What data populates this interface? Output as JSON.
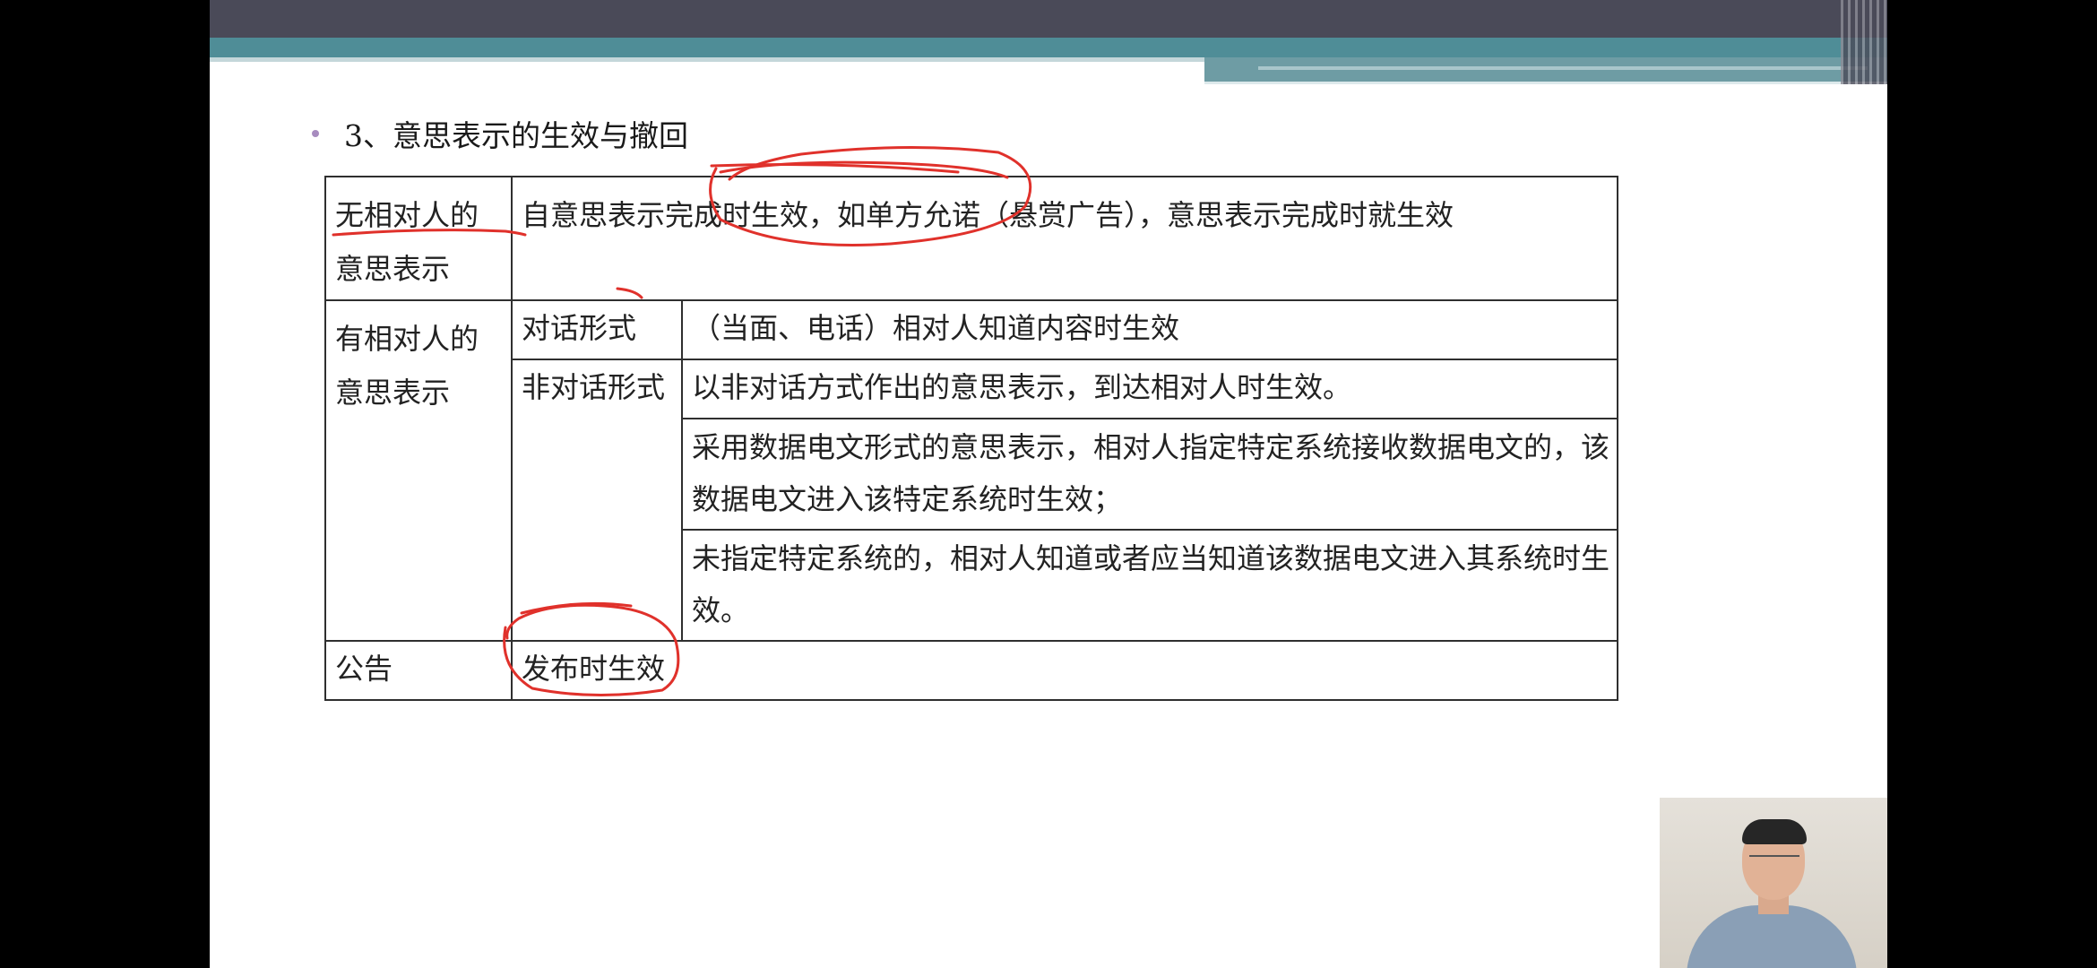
{
  "slide": {
    "heading": "3、意思表示的生效与撤回",
    "rows": {
      "no_counterparty": {
        "label": "无相对人的意思表示",
        "content": "自意思表示完成时生效，如单方允诺（悬赏广告），意思表示完成时就生效"
      },
      "with_counterparty": {
        "label": "有相对人的意思表示",
        "dialogue": {
          "form": "对话形式",
          "content": "（当面、电话）相对人知道内容时生效"
        },
        "non_dialogue": {
          "form": "非对话形式",
          "content": "以非对话方式作出的意思表示，到达相对人时生效。",
          "electronic_designated": "采用数据电文形式的意思表示，相对人指定特定系统接收数据电文的，该数据电文进入该特定系统时生效；",
          "electronic_undesignated": "未指定特定系统的，相对人知道或者应当知道该数据电文进入其系统时生效。"
        }
      },
      "announcement": {
        "label": "公告",
        "content": "发布时生效"
      }
    }
  },
  "colors": {
    "header_dark": "#4a4a58",
    "header_teal": "#4f8d97",
    "bullet": "#a78bbf",
    "annotation_ink": "#e0312b"
  },
  "icons": [
    "bullet-dot",
    "presenter-webcam"
  ]
}
